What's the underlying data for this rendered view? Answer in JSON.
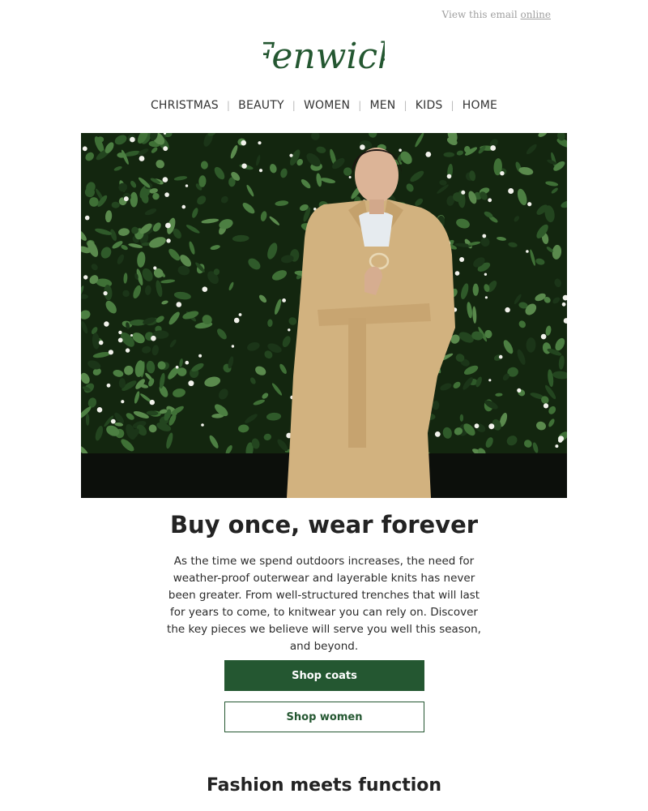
{
  "header": {
    "view_text": "View this email",
    "view_link": "online"
  },
  "brand": {
    "name": "Fenwick",
    "color": "#245731"
  },
  "nav": {
    "items": [
      "CHRISTMAS",
      "BEAUTY",
      "WOMEN",
      "MEN",
      "KIDS",
      "HOME"
    ],
    "separator": "|"
  },
  "hero": {
    "icon": "model-in-camel-coat-photo"
  },
  "main": {
    "title": "Buy once, wear forever",
    "body": "As the time we spend outdoors increases, the need for weather-proof outerwear and layerable knits has never been greater. From well-structured trenches that will last for years to come, to knitwear you can rely on. Discover the key pieces we believe will serve you well this season, and beyond.",
    "primary_button": "Shop coats",
    "secondary_button": "Shop women"
  },
  "section2": {
    "title": "Fashion meets function"
  },
  "colors": {
    "accent": "#245731",
    "text": "#222222",
    "muted": "#a0a0a0"
  }
}
